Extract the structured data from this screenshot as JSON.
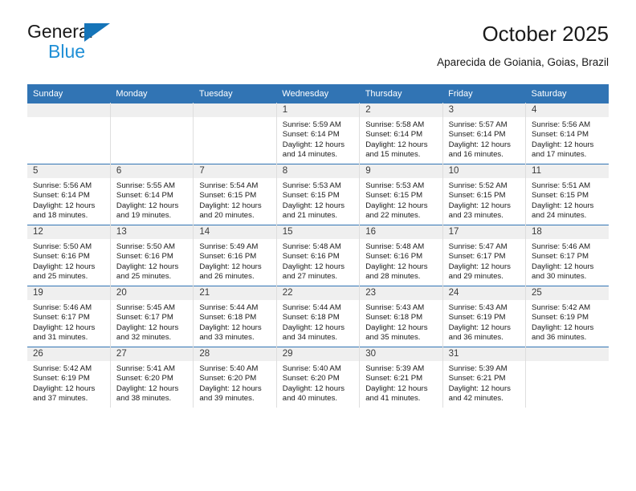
{
  "brand": {
    "name_top": "General",
    "name_bottom": "Blue",
    "accent_color": "#1f8fd6",
    "triangle_color": "#1574b8"
  },
  "header": {
    "title": "October 2025",
    "subtitle": "Aparecida de Goiania, Goias, Brazil"
  },
  "theme": {
    "header_row_bg": "#3174b4",
    "daynum_bg": "#efefef",
    "cell_bg": "#ffffff",
    "text_color": "#1a1a1a"
  },
  "weekdays": [
    "Sunday",
    "Monday",
    "Tuesday",
    "Wednesday",
    "Thursday",
    "Friday",
    "Saturday"
  ],
  "labels": {
    "sunrise_prefix": "Sunrise:",
    "sunset_prefix": "Sunset:",
    "daylight_prefix": "Daylight:"
  },
  "weeks": [
    [
      {
        "day": "",
        "sunrise": "",
        "sunset": "",
        "daylight_line1": "",
        "daylight_line2": ""
      },
      {
        "day": "",
        "sunrise": "",
        "sunset": "",
        "daylight_line1": "",
        "daylight_line2": ""
      },
      {
        "day": "",
        "sunrise": "",
        "sunset": "",
        "daylight_line1": "",
        "daylight_line2": ""
      },
      {
        "day": "1",
        "sunrise": "Sunrise: 5:59 AM",
        "sunset": "Sunset: 6:14 PM",
        "daylight_line1": "Daylight: 12 hours",
        "daylight_line2": "and 14 minutes."
      },
      {
        "day": "2",
        "sunrise": "Sunrise: 5:58 AM",
        "sunset": "Sunset: 6:14 PM",
        "daylight_line1": "Daylight: 12 hours",
        "daylight_line2": "and 15 minutes."
      },
      {
        "day": "3",
        "sunrise": "Sunrise: 5:57 AM",
        "sunset": "Sunset: 6:14 PM",
        "daylight_line1": "Daylight: 12 hours",
        "daylight_line2": "and 16 minutes."
      },
      {
        "day": "4",
        "sunrise": "Sunrise: 5:56 AM",
        "sunset": "Sunset: 6:14 PM",
        "daylight_line1": "Daylight: 12 hours",
        "daylight_line2": "and 17 minutes."
      }
    ],
    [
      {
        "day": "5",
        "sunrise": "Sunrise: 5:56 AM",
        "sunset": "Sunset: 6:14 PM",
        "daylight_line1": "Daylight: 12 hours",
        "daylight_line2": "and 18 minutes."
      },
      {
        "day": "6",
        "sunrise": "Sunrise: 5:55 AM",
        "sunset": "Sunset: 6:14 PM",
        "daylight_line1": "Daylight: 12 hours",
        "daylight_line2": "and 19 minutes."
      },
      {
        "day": "7",
        "sunrise": "Sunrise: 5:54 AM",
        "sunset": "Sunset: 6:15 PM",
        "daylight_line1": "Daylight: 12 hours",
        "daylight_line2": "and 20 minutes."
      },
      {
        "day": "8",
        "sunrise": "Sunrise: 5:53 AM",
        "sunset": "Sunset: 6:15 PM",
        "daylight_line1": "Daylight: 12 hours",
        "daylight_line2": "and 21 minutes."
      },
      {
        "day": "9",
        "sunrise": "Sunrise: 5:53 AM",
        "sunset": "Sunset: 6:15 PM",
        "daylight_line1": "Daylight: 12 hours",
        "daylight_line2": "and 22 minutes."
      },
      {
        "day": "10",
        "sunrise": "Sunrise: 5:52 AM",
        "sunset": "Sunset: 6:15 PM",
        "daylight_line1": "Daylight: 12 hours",
        "daylight_line2": "and 23 minutes."
      },
      {
        "day": "11",
        "sunrise": "Sunrise: 5:51 AM",
        "sunset": "Sunset: 6:15 PM",
        "daylight_line1": "Daylight: 12 hours",
        "daylight_line2": "and 24 minutes."
      }
    ],
    [
      {
        "day": "12",
        "sunrise": "Sunrise: 5:50 AM",
        "sunset": "Sunset: 6:16 PM",
        "daylight_line1": "Daylight: 12 hours",
        "daylight_line2": "and 25 minutes."
      },
      {
        "day": "13",
        "sunrise": "Sunrise: 5:50 AM",
        "sunset": "Sunset: 6:16 PM",
        "daylight_line1": "Daylight: 12 hours",
        "daylight_line2": "and 25 minutes."
      },
      {
        "day": "14",
        "sunrise": "Sunrise: 5:49 AM",
        "sunset": "Sunset: 6:16 PM",
        "daylight_line1": "Daylight: 12 hours",
        "daylight_line2": "and 26 minutes."
      },
      {
        "day": "15",
        "sunrise": "Sunrise: 5:48 AM",
        "sunset": "Sunset: 6:16 PM",
        "daylight_line1": "Daylight: 12 hours",
        "daylight_line2": "and 27 minutes."
      },
      {
        "day": "16",
        "sunrise": "Sunrise: 5:48 AM",
        "sunset": "Sunset: 6:16 PM",
        "daylight_line1": "Daylight: 12 hours",
        "daylight_line2": "and 28 minutes."
      },
      {
        "day": "17",
        "sunrise": "Sunrise: 5:47 AM",
        "sunset": "Sunset: 6:17 PM",
        "daylight_line1": "Daylight: 12 hours",
        "daylight_line2": "and 29 minutes."
      },
      {
        "day": "18",
        "sunrise": "Sunrise: 5:46 AM",
        "sunset": "Sunset: 6:17 PM",
        "daylight_line1": "Daylight: 12 hours",
        "daylight_line2": "and 30 minutes."
      }
    ],
    [
      {
        "day": "19",
        "sunrise": "Sunrise: 5:46 AM",
        "sunset": "Sunset: 6:17 PM",
        "daylight_line1": "Daylight: 12 hours",
        "daylight_line2": "and 31 minutes."
      },
      {
        "day": "20",
        "sunrise": "Sunrise: 5:45 AM",
        "sunset": "Sunset: 6:17 PM",
        "daylight_line1": "Daylight: 12 hours",
        "daylight_line2": "and 32 minutes."
      },
      {
        "day": "21",
        "sunrise": "Sunrise: 5:44 AM",
        "sunset": "Sunset: 6:18 PM",
        "daylight_line1": "Daylight: 12 hours",
        "daylight_line2": "and 33 minutes."
      },
      {
        "day": "22",
        "sunrise": "Sunrise: 5:44 AM",
        "sunset": "Sunset: 6:18 PM",
        "daylight_line1": "Daylight: 12 hours",
        "daylight_line2": "and 34 minutes."
      },
      {
        "day": "23",
        "sunrise": "Sunrise: 5:43 AM",
        "sunset": "Sunset: 6:18 PM",
        "daylight_line1": "Daylight: 12 hours",
        "daylight_line2": "and 35 minutes."
      },
      {
        "day": "24",
        "sunrise": "Sunrise: 5:43 AM",
        "sunset": "Sunset: 6:19 PM",
        "daylight_line1": "Daylight: 12 hours",
        "daylight_line2": "and 36 minutes."
      },
      {
        "day": "25",
        "sunrise": "Sunrise: 5:42 AM",
        "sunset": "Sunset: 6:19 PM",
        "daylight_line1": "Daylight: 12 hours",
        "daylight_line2": "and 36 minutes."
      }
    ],
    [
      {
        "day": "26",
        "sunrise": "Sunrise: 5:42 AM",
        "sunset": "Sunset: 6:19 PM",
        "daylight_line1": "Daylight: 12 hours",
        "daylight_line2": "and 37 minutes."
      },
      {
        "day": "27",
        "sunrise": "Sunrise: 5:41 AM",
        "sunset": "Sunset: 6:20 PM",
        "daylight_line1": "Daylight: 12 hours",
        "daylight_line2": "and 38 minutes."
      },
      {
        "day": "28",
        "sunrise": "Sunrise: 5:40 AM",
        "sunset": "Sunset: 6:20 PM",
        "daylight_line1": "Daylight: 12 hours",
        "daylight_line2": "and 39 minutes."
      },
      {
        "day": "29",
        "sunrise": "Sunrise: 5:40 AM",
        "sunset": "Sunset: 6:20 PM",
        "daylight_line1": "Daylight: 12 hours",
        "daylight_line2": "and 40 minutes."
      },
      {
        "day": "30",
        "sunrise": "Sunrise: 5:39 AM",
        "sunset": "Sunset: 6:21 PM",
        "daylight_line1": "Daylight: 12 hours",
        "daylight_line2": "and 41 minutes."
      },
      {
        "day": "31",
        "sunrise": "Sunrise: 5:39 AM",
        "sunset": "Sunset: 6:21 PM",
        "daylight_line1": "Daylight: 12 hours",
        "daylight_line2": "and 42 minutes."
      },
      {
        "day": "",
        "sunrise": "",
        "sunset": "",
        "daylight_line1": "",
        "daylight_line2": ""
      }
    ]
  ]
}
